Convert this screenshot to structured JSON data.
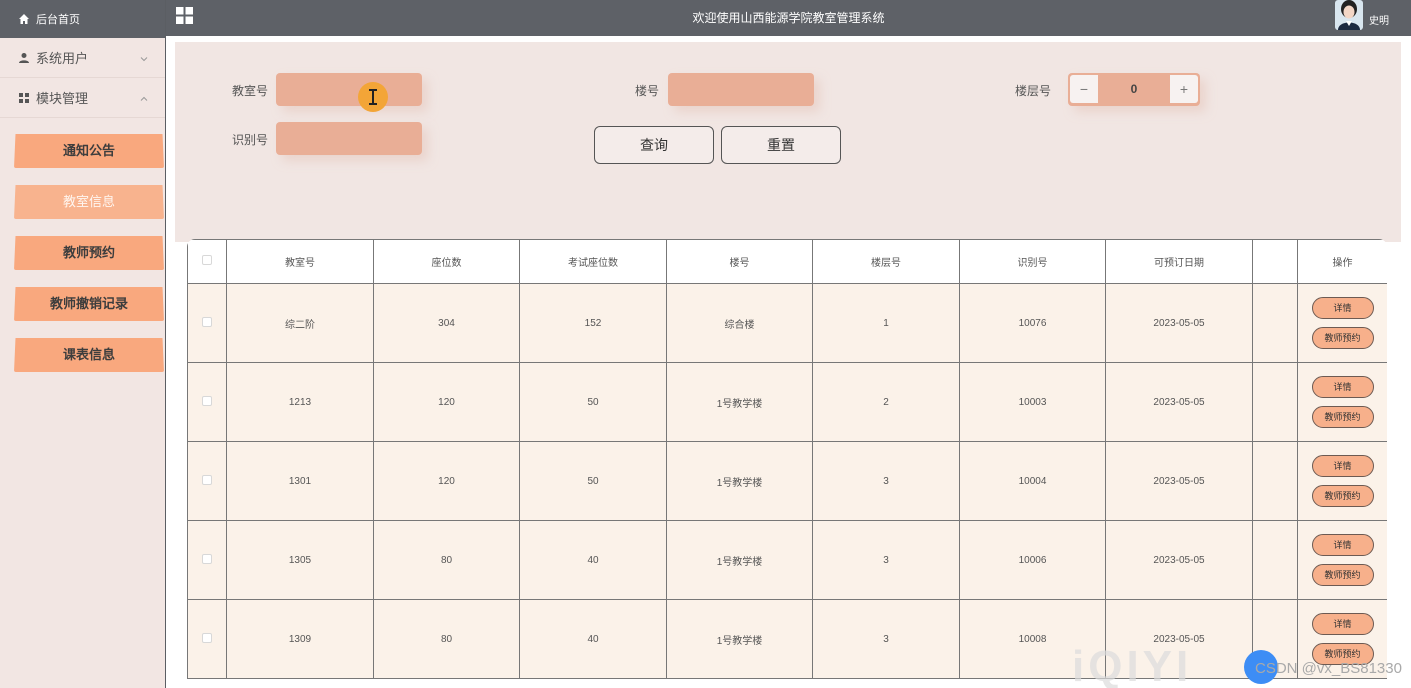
{
  "header": {
    "title": "欢迎使用山西能源学院教室管理系统",
    "username": "史明"
  },
  "sidebar": {
    "home": "后台首页",
    "groups": [
      {
        "label": "系统用户"
      },
      {
        "label": "模块管理"
      }
    ],
    "items": [
      {
        "label": "通知公告"
      },
      {
        "label": "教室信息"
      },
      {
        "label": "教师预约"
      },
      {
        "label": "教师撤销记录"
      },
      {
        "label": "课表信息"
      }
    ]
  },
  "search": {
    "classroom_label": "教室号",
    "building_label": "楼号",
    "floor_label": "楼层号",
    "floor_value": "0",
    "id_label": "识别号",
    "query_btn": "查询",
    "reset_btn": "重置"
  },
  "table": {
    "headers": [
      "教室号",
      "座位数",
      "考试座位数",
      "楼号",
      "楼层号",
      "识别号",
      "可预订日期",
      "",
      "操作"
    ],
    "detail_btn": "详情",
    "reserve_btn": "教师预约",
    "rows": [
      {
        "room": "综二阶",
        "seats": "304",
        "exam_seats": "152",
        "building": "综合楼",
        "floor": "1",
        "code": "10076",
        "date": "2023-05-05"
      },
      {
        "room": "1213",
        "seats": "120",
        "exam_seats": "50",
        "building": "1号教学楼",
        "floor": "2",
        "code": "10003",
        "date": "2023-05-05"
      },
      {
        "room": "1301",
        "seats": "120",
        "exam_seats": "50",
        "building": "1号教学楼",
        "floor": "3",
        "code": "10004",
        "date": "2023-05-05"
      },
      {
        "room": "1305",
        "seats": "80",
        "exam_seats": "40",
        "building": "1号教学楼",
        "floor": "3",
        "code": "10006",
        "date": "2023-05-05"
      },
      {
        "room": "1309",
        "seats": "80",
        "exam_seats": "40",
        "building": "1号教学楼",
        "floor": "3",
        "code": "10008",
        "date": "2023-05-05"
      }
    ]
  },
  "watermark": {
    "csdn": "CSDN @vx_BS81330",
    "iqiyi": "iQIYI"
  },
  "colors": {
    "topbar": "#5e6167",
    "sidebar": "#f2e6e3",
    "menu_button": "#f9a87e",
    "input": "#e9ae96",
    "row_bg": "#fbf2e9"
  }
}
